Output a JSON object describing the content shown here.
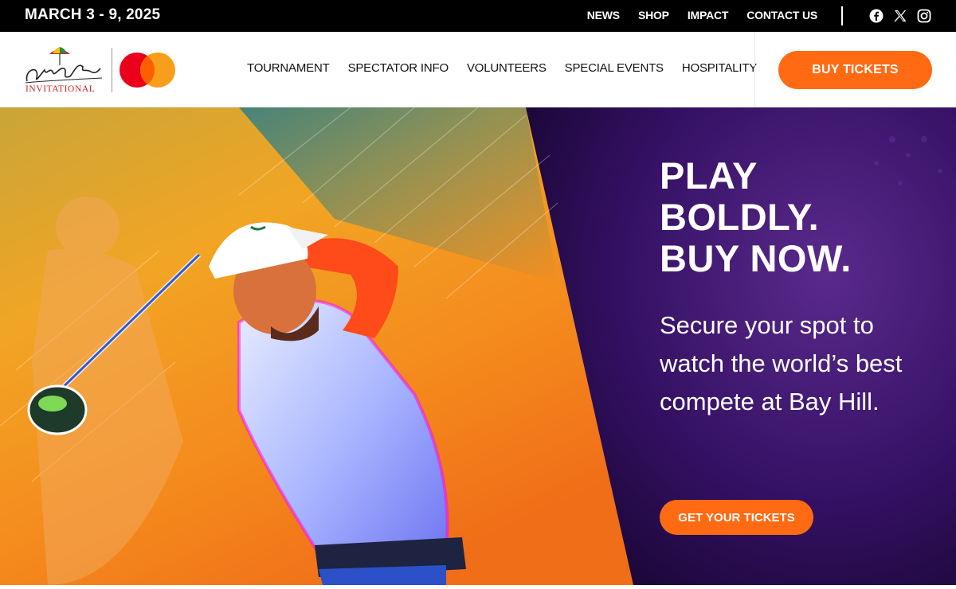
{
  "topbar": {
    "dates": "MARCH 3 - 9, 2025",
    "links": [
      "NEWS",
      "SHOP",
      "IMPACT",
      "CONTACT US"
    ],
    "social_icons": [
      "facebook-icon",
      "x-icon",
      "instagram-icon"
    ]
  },
  "header": {
    "logo_text": "INVITATIONAL",
    "nav": [
      "TOURNAMENT",
      "SPECTATOR INFO",
      "VOLUNTEERS",
      "SPECIAL EVENTS",
      "HOSPITALITY"
    ],
    "buy_label": "BUY TICKETS"
  },
  "hero": {
    "title_lines": [
      "PLAY",
      "BOLDLY.",
      "BUY NOW."
    ],
    "subtitle": "Secure your spot to watch the world’s best compete at Bay Hill.",
    "cta_label": "GET YOUR TICKETS"
  },
  "colors": {
    "accent": "#ff6a13",
    "topbar": "#000000",
    "hero_panel": "#2a0e4a",
    "mastercard_red": "#eb001b",
    "mastercard_yellow": "#f79e1b"
  }
}
